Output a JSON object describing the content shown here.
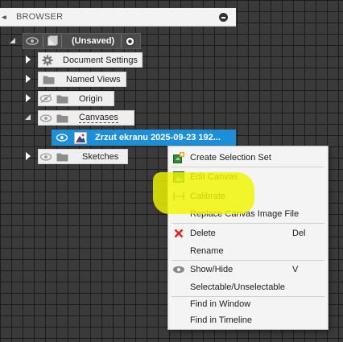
{
  "browser": {
    "collapse_glyph": "◂◂",
    "title": "BROWSER"
  },
  "tree": {
    "root": {
      "label": "(Unsaved)"
    },
    "items": [
      {
        "label": "Document Settings",
        "icon": "gear-icon"
      },
      {
        "label": "Named Views",
        "icon": "folder-icon"
      },
      {
        "label": "Origin",
        "icon": "folder-icon"
      },
      {
        "label": "Canvases",
        "icon": "folder-icon"
      },
      {
        "label": "Zrzut ekranu 2025-09-23 192...",
        "icon": "canvas-image-icon"
      },
      {
        "label": "Sketches",
        "icon": "folder-icon"
      }
    ]
  },
  "context_menu": {
    "items": [
      {
        "label": "Create Selection Set",
        "shortcut": "",
        "icon": "selection-set-icon"
      },
      {
        "label": "Edit Canvas",
        "shortcut": "",
        "icon": "edit-canvas-icon"
      },
      {
        "label": "Calibrate",
        "shortcut": "",
        "icon": "calibrate-icon"
      },
      {
        "label": "Replace Canvas Image File",
        "shortcut": "",
        "icon": ""
      },
      {
        "label": "Delete",
        "shortcut": "Del",
        "icon": "delete-x-icon"
      },
      {
        "label": "Rename",
        "shortcut": "",
        "icon": ""
      },
      {
        "label": "Show/Hide",
        "shortcut": "V",
        "icon": "eye-icon"
      },
      {
        "label": "Selectable/Unselectable",
        "shortcut": "",
        "icon": ""
      },
      {
        "label": "Find in Window",
        "shortcut": "",
        "icon": ""
      },
      {
        "label": "Find in Timeline",
        "shortcut": "",
        "icon": ""
      }
    ]
  },
  "colors": {
    "canvas_background": "#3a3a3a",
    "grid_line": "#1c1c1c",
    "selection_blue": "#1d8fd8",
    "annotation_highlight": "#f0f500",
    "delete_red": "#d9281e"
  }
}
